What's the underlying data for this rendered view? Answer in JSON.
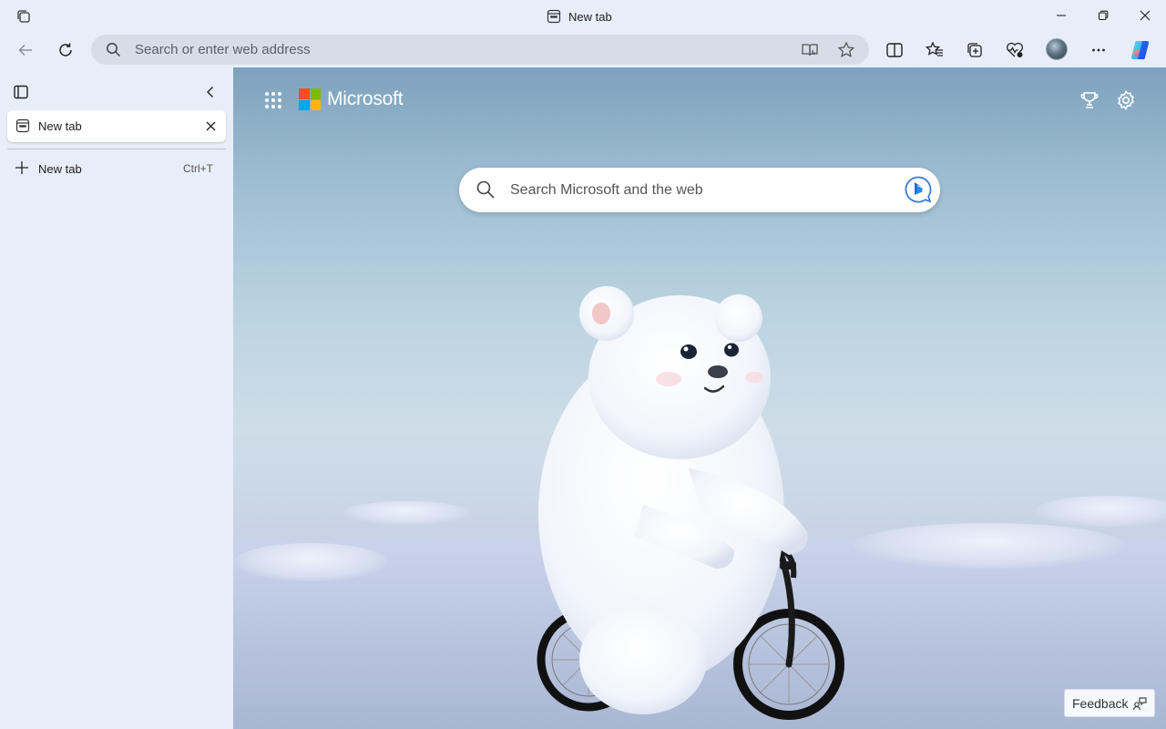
{
  "window": {
    "title": "New tab",
    "icons": {
      "workspaces": "workspaces-icon",
      "tab": "tab-page-icon",
      "minimize": "minimize-icon",
      "restore": "restore-icon",
      "close": "close-icon"
    }
  },
  "toolbar": {
    "address_placeholder": "Search or enter web address",
    "icons": [
      "back-icon",
      "refresh-icon",
      "search-icon",
      "immersive-reader-icon",
      "favorite-star-icon",
      "split-screen-icon",
      "favorites-icon",
      "collections-icon",
      "browser-essentials-icon",
      "profile-avatar",
      "more-icon",
      "copilot-icon"
    ]
  },
  "sidebar": {
    "tabs": [
      {
        "label": "New tab",
        "active": true
      }
    ],
    "new_tab": {
      "label": "New tab",
      "shortcut": "Ctrl+T"
    }
  },
  "newtab_page": {
    "brand": "Microsoft",
    "search_placeholder": "Search Microsoft and the web",
    "feedback_label": "Feedback",
    "background": "polar bear cub riding a bicycle on snowy landscape",
    "icons": [
      "apps-grid-icon",
      "microsoft-logo",
      "rewards-trophy-icon",
      "settings-gear-icon",
      "bing-icon",
      "feedback-share-icon"
    ]
  },
  "colors": {
    "chrome_bg": "#e8eef9",
    "address_bg": "#d6dce8",
    "ms_red": "#f25022",
    "ms_green": "#7fba00",
    "ms_blue": "#00a4ef",
    "ms_yellow": "#ffb900"
  }
}
